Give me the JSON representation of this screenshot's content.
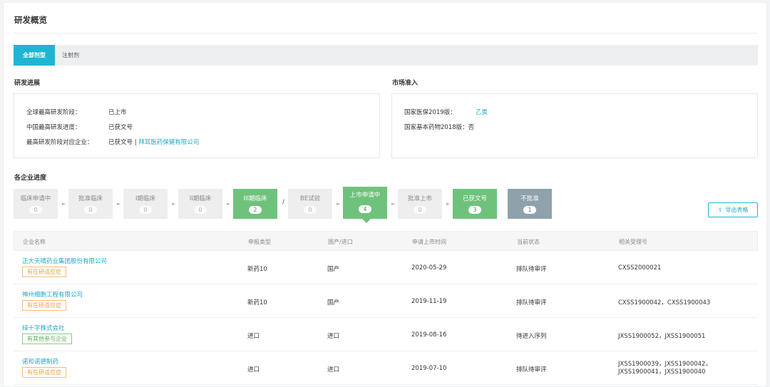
{
  "page": {
    "title": "研发概览"
  },
  "tabs": [
    {
      "label": "全部剂型",
      "active": true
    },
    {
      "label": "注射剂",
      "active": false
    }
  ],
  "progress": {
    "title": "研发进展",
    "rows": [
      {
        "label": "全球最高研发阶段：",
        "value": "已上市"
      },
      {
        "label": "中国最高研发进度：",
        "value": "已获文号"
      },
      {
        "label": "最高研发阶段对应企业：",
        "value": "已获文号 | ",
        "link": "拜耳医药保健有限公司"
      }
    ]
  },
  "market": {
    "title": "市场准入",
    "rows": [
      {
        "label": "国家医保2019版：",
        "value": "乙类"
      },
      {
        "label": "国家基本药物2018版：",
        "value": "否"
      }
    ]
  },
  "companies": {
    "title": "各企业进度",
    "stages": [
      {
        "label": "临床申请中",
        "count": "0",
        "style": "default"
      },
      {
        "label": "批准临床",
        "count": "0",
        "style": "default"
      },
      {
        "label": "I期临床",
        "count": "0",
        "style": "default"
      },
      {
        "label": "II期临床",
        "count": "0",
        "style": "default"
      },
      {
        "label": "III期临床",
        "count": "2",
        "style": "green"
      },
      {
        "label": "BE试验",
        "count": "0",
        "style": "default"
      },
      {
        "label": "上市申请中",
        "count": "4",
        "style": "green-selected"
      },
      {
        "label": "批准上市",
        "count": "0",
        "style": "default"
      },
      {
        "label": "已获文号",
        "count": "3",
        "style": "green"
      },
      {
        "label": "不批准",
        "count": "1",
        "style": "grey"
      }
    ],
    "separator_arrow": "►",
    "separator_slash": "/",
    "export_label": "导出表格",
    "export_icon": "export-icon"
  },
  "table": {
    "headers": [
      "企业名称",
      "申报类型",
      "国产/进口",
      "申请上市时间",
      "当前状态",
      "相关受理号"
    ],
    "rows": [
      {
        "company": "正大天晴药业集团股份有限公司",
        "tag": "有在研适应症",
        "tag_color": "orange",
        "type": "新药10",
        "origin": "国产",
        "date": "2020-05-29",
        "status": "排队待审评",
        "numbers": "CXSS2000021",
        "numbers2": ""
      },
      {
        "company": "神州细胞工程有限公司",
        "tag": "有在研适应症",
        "tag_color": "orange",
        "type": "新药10",
        "origin": "国产",
        "date": "2019-11-19",
        "status": "排队待审评",
        "numbers": "CXSS1900042，CXSS1900043",
        "numbers2": ""
      },
      {
        "company": "绿十字株式会社",
        "tag": "有其他参与企业",
        "tag_color": "green",
        "type": "进口",
        "origin": "进口",
        "date": "2019-08-16",
        "status": "待进入序列",
        "numbers": "JXSS1900052，JXSS1900051",
        "numbers2": ""
      },
      {
        "company": "诺和诺德制药",
        "tag": "有在研适应症",
        "tag_color": "orange",
        "type": "进口",
        "origin": "进口",
        "date": "2019-07-10",
        "status": "排队待审评",
        "numbers": "JXSS1900039，JXSS1900042，",
        "numbers2": "JXSS1900041，JXSS1900040"
      }
    ]
  },
  "colors": {
    "accent": "#1fb5d2",
    "link": "#1fa8c7",
    "green": "#6fc27c",
    "grey": "#8fa1ab",
    "orange": "#f0a13c"
  }
}
